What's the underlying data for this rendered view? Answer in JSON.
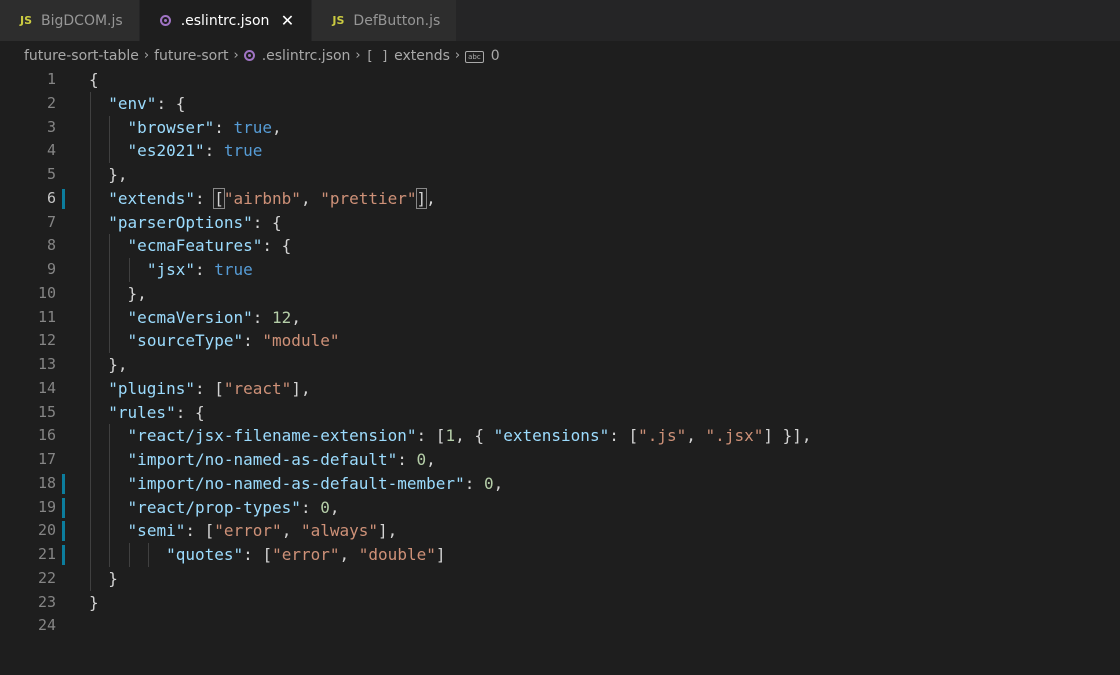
{
  "tabs": [
    {
      "label": "BigDCOM.js",
      "icon": "js-icon",
      "active": false
    },
    {
      "label": ".eslintrc.json",
      "icon": "eslint-icon",
      "active": true
    },
    {
      "label": "DefButton.js",
      "icon": "js-icon",
      "active": false
    }
  ],
  "tab_icon_text": "JS",
  "close_glyph": "✕",
  "breadcrumb": {
    "items": [
      "future-sort-table",
      "future-sort",
      ".eslintrc.json",
      "extends",
      "0"
    ],
    "bracket_glyph": "[ ]",
    "abc_glyph": "abc"
  },
  "colors": {
    "key": "#9cdcfe",
    "string": "#ce9178",
    "boolean": "#569cd6",
    "number": "#b5cea8",
    "gutter_modified": "#0c7d9d"
  },
  "editor": {
    "current_line": 6,
    "lines": [
      {
        "n": "1",
        "indent": 0,
        "mark": false,
        "tokens": [
          [
            "p",
            "{"
          ]
        ]
      },
      {
        "n": "2",
        "indent": 1,
        "mark": false,
        "tokens": [
          [
            "k",
            "\"env\""
          ],
          [
            "p",
            ": {"
          ]
        ]
      },
      {
        "n": "3",
        "indent": 2,
        "mark": false,
        "tokens": [
          [
            "k",
            "\"browser\""
          ],
          [
            "p",
            ": "
          ],
          [
            "b",
            "true"
          ],
          [
            "p",
            ","
          ]
        ]
      },
      {
        "n": "4",
        "indent": 2,
        "mark": false,
        "tokens": [
          [
            "k",
            "\"es2021\""
          ],
          [
            "p",
            ": "
          ],
          [
            "b",
            "true"
          ]
        ]
      },
      {
        "n": "5",
        "indent": 1,
        "mark": false,
        "tokens": [
          [
            "p",
            "},"
          ]
        ]
      },
      {
        "n": "6",
        "indent": 1,
        "mark": true,
        "tokens": [
          [
            "k",
            "\"extends\""
          ],
          [
            "p",
            ": "
          ],
          [
            "h",
            "["
          ],
          [
            "s",
            "\"airbnb\""
          ],
          [
            "p",
            ", "
          ],
          [
            "s",
            "\"prettier\""
          ],
          [
            "h",
            "]"
          ],
          [
            "p",
            ","
          ]
        ]
      },
      {
        "n": "7",
        "indent": 1,
        "mark": false,
        "tokens": [
          [
            "k",
            "\"parserOptions\""
          ],
          [
            "p",
            ": {"
          ]
        ]
      },
      {
        "n": "8",
        "indent": 2,
        "mark": false,
        "tokens": [
          [
            "k",
            "\"ecmaFeatures\""
          ],
          [
            "p",
            ": {"
          ]
        ]
      },
      {
        "n": "9",
        "indent": 3,
        "mark": false,
        "tokens": [
          [
            "k",
            "\"jsx\""
          ],
          [
            "p",
            ": "
          ],
          [
            "b",
            "true"
          ]
        ]
      },
      {
        "n": "10",
        "indent": 2,
        "mark": false,
        "tokens": [
          [
            "p",
            "},"
          ]
        ]
      },
      {
        "n": "11",
        "indent": 2,
        "mark": false,
        "tokens": [
          [
            "k",
            "\"ecmaVersion\""
          ],
          [
            "p",
            ": "
          ],
          [
            "n",
            "12"
          ],
          [
            "p",
            ","
          ]
        ]
      },
      {
        "n": "12",
        "indent": 2,
        "mark": false,
        "tokens": [
          [
            "k",
            "\"sourceType\""
          ],
          [
            "p",
            ": "
          ],
          [
            "s",
            "\"module\""
          ]
        ]
      },
      {
        "n": "13",
        "indent": 1,
        "mark": false,
        "tokens": [
          [
            "p",
            "},"
          ]
        ]
      },
      {
        "n": "14",
        "indent": 1,
        "mark": false,
        "tokens": [
          [
            "k",
            "\"plugins\""
          ],
          [
            "p",
            ": ["
          ],
          [
            "s",
            "\"react\""
          ],
          [
            "p",
            "],"
          ]
        ]
      },
      {
        "n": "15",
        "indent": 1,
        "mark": false,
        "tokens": [
          [
            "k",
            "\"rules\""
          ],
          [
            "p",
            ": {"
          ]
        ]
      },
      {
        "n": "16",
        "indent": 2,
        "mark": false,
        "tokens": [
          [
            "k",
            "\"react/jsx-filename-extension\""
          ],
          [
            "p",
            ": ["
          ],
          [
            "n",
            "1"
          ],
          [
            "p",
            ", { "
          ],
          [
            "k",
            "\"extensions\""
          ],
          [
            "p",
            ": ["
          ],
          [
            "s",
            "\".js\""
          ],
          [
            "p",
            ", "
          ],
          [
            "s",
            "\".jsx\""
          ],
          [
            "p",
            "] }],"
          ]
        ]
      },
      {
        "n": "17",
        "indent": 2,
        "mark": false,
        "tokens": [
          [
            "k",
            "\"import/no-named-as-default\""
          ],
          [
            "p",
            ": "
          ],
          [
            "n",
            "0"
          ],
          [
            "p",
            ","
          ]
        ]
      },
      {
        "n": "18",
        "indent": 2,
        "mark": true,
        "tokens": [
          [
            "k",
            "\"import/no-named-as-default-member\""
          ],
          [
            "p",
            ": "
          ],
          [
            "n",
            "0"
          ],
          [
            "p",
            ","
          ]
        ]
      },
      {
        "n": "19",
        "indent": 2,
        "mark": true,
        "tokens": [
          [
            "k",
            "\"react/prop-types\""
          ],
          [
            "p",
            ": "
          ],
          [
            "n",
            "0"
          ],
          [
            "p",
            ","
          ]
        ]
      },
      {
        "n": "20",
        "indent": 2,
        "mark": true,
        "tokens": [
          [
            "k",
            "\"semi\""
          ],
          [
            "p",
            ": ["
          ],
          [
            "s",
            "\"error\""
          ],
          [
            "p",
            ", "
          ],
          [
            "s",
            "\"always\""
          ],
          [
            "p",
            "],"
          ]
        ]
      },
      {
        "n": "21",
        "indent": 4,
        "mark": true,
        "tokens": [
          [
            "k",
            "\"quotes\""
          ],
          [
            "p",
            ": ["
          ],
          [
            "s",
            "\"error\""
          ],
          [
            "p",
            ", "
          ],
          [
            "s",
            "\"double\""
          ],
          [
            "p",
            "]"
          ]
        ]
      },
      {
        "n": "22",
        "indent": 1,
        "mark": false,
        "tokens": [
          [
            "p",
            "}"
          ]
        ]
      },
      {
        "n": "23",
        "indent": 0,
        "mark": false,
        "tokens": [
          [
            "p",
            "}"
          ]
        ]
      },
      {
        "n": "24",
        "indent": 0,
        "mark": false,
        "tokens": []
      }
    ]
  }
}
